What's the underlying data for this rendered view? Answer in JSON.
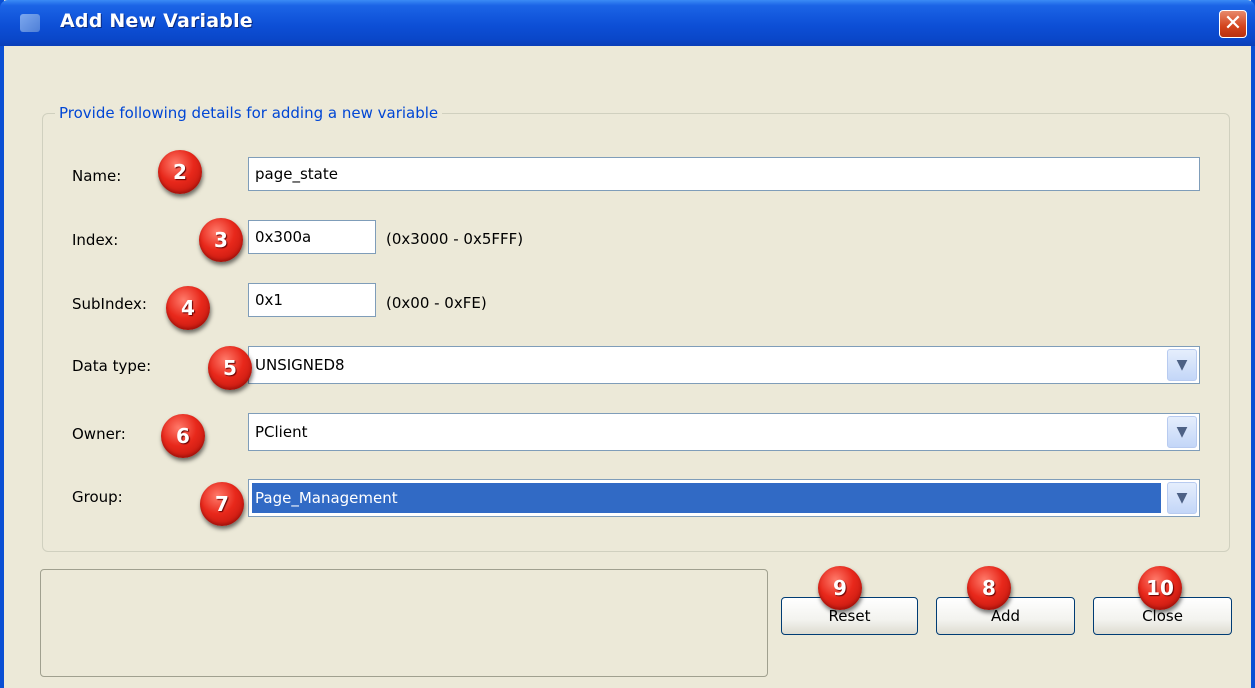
{
  "window": {
    "title": "Add New Variable",
    "close_glyph": "✕"
  },
  "form": {
    "legend": "Provide following details for adding a new variable",
    "name_label": "Name:",
    "name_value": "page_state",
    "index_label": "Index:",
    "index_value": "0x300a",
    "index_hint": "(0x3000 - 0x5FFF)",
    "subindex_label": "SubIndex:",
    "subindex_value": "0x1",
    "subindex_hint": "(0x00 - 0xFE)",
    "datatype_label": "Data type:",
    "datatype_value": "UNSIGNED8",
    "owner_label": "Owner:",
    "owner_value": "PClient",
    "group_label": "Group:",
    "group_value": "Page_Management"
  },
  "buttons": {
    "reset": "Reset",
    "add": "Add",
    "close": "Close"
  },
  "badges": {
    "name": "2",
    "index": "3",
    "subindex": "4",
    "datatype": "5",
    "owner": "6",
    "group": "7",
    "add": "8",
    "reset": "9",
    "close": "10"
  },
  "icons": {
    "combo_arrow": "chevron-down-icon",
    "close": "close-icon"
  },
  "colors": {
    "title_bar": "#0a47c9",
    "legend_text": "#0046d5",
    "selection": "#316ac5",
    "badge": "#e8281b"
  }
}
